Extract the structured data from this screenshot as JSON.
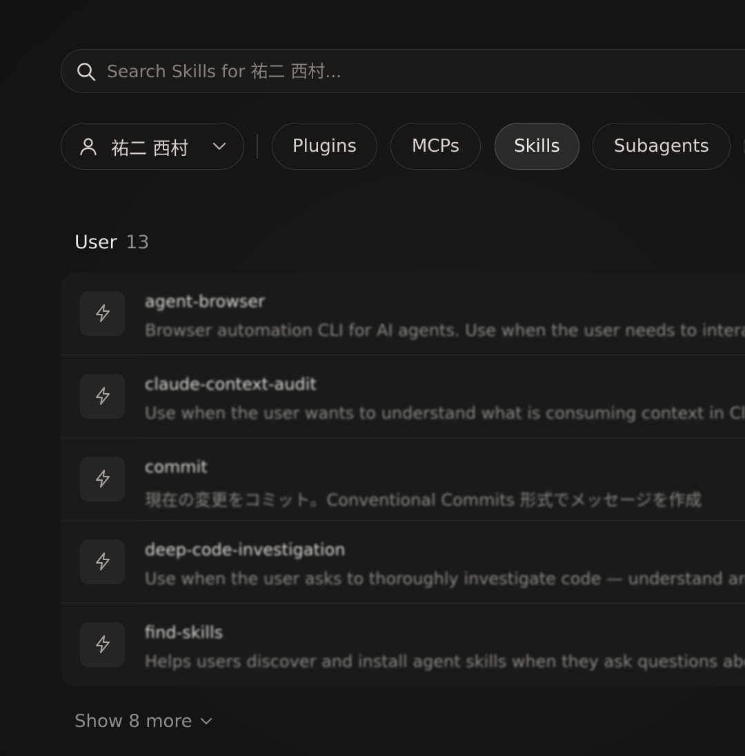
{
  "search": {
    "placeholder": "Search Skills for 祐二 西村..."
  },
  "filters": {
    "user_chip_label": "祐二 西村",
    "chips": [
      {
        "label": "Plugins",
        "active": false
      },
      {
        "label": "MCPs",
        "active": false
      },
      {
        "label": "Skills",
        "active": true
      },
      {
        "label": "Subagents",
        "active": false
      }
    ]
  },
  "section": {
    "title": "User",
    "count": "13"
  },
  "skills": [
    {
      "name": "agent-browser",
      "description": "Browser automation CLI for AI agents. Use when the user needs to interact with websites"
    },
    {
      "name": "claude-context-audit",
      "description": "Use when the user wants to understand what is consuming context in Claude sessions"
    },
    {
      "name": "commit",
      "description": "現在の変更をコミット。Conventional Commits 形式でメッセージを作成"
    },
    {
      "name": "deep-code-investigation",
      "description": "Use when the user asks to thoroughly investigate code — understand architecture"
    },
    {
      "name": "find-skills",
      "description": "Helps users discover and install agent skills when they ask questions about"
    }
  ],
  "show_more": {
    "label": "Show 8 more"
  },
  "colors": {
    "background": "#151414",
    "card": "#1b1a19",
    "active_chip": "#2b2a28",
    "muted_text": "#8f8c88"
  }
}
